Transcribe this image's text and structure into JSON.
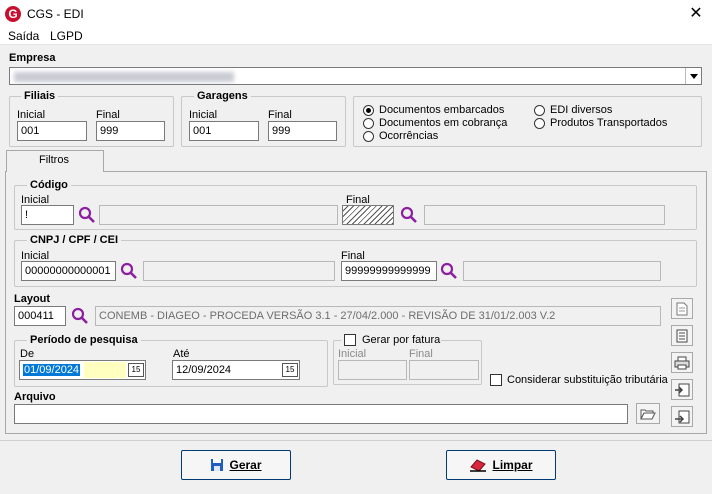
{
  "window": {
    "title": "CGS - EDI",
    "close_glyph": "✕"
  },
  "menu": [
    "Saída",
    "LGPD"
  ],
  "empresa": {
    "label": "Empresa",
    "value": ""
  },
  "filiais": {
    "label": "Filiais",
    "inicial_label": "Inicial",
    "inicial": "001",
    "final_label": "Final",
    "final": "999"
  },
  "garagens": {
    "label": "Garagens",
    "inicial_label": "Inicial",
    "inicial": "001",
    "final_label": "Final",
    "final": "999"
  },
  "doc_options": [
    {
      "label": "Documentos embarcados",
      "selected": true
    },
    {
      "label": "Documentos em cobrança",
      "selected": false
    },
    {
      "label": "Ocorrências",
      "selected": false
    },
    {
      "label": "EDI diversos",
      "selected": false
    },
    {
      "label": "Produtos Transportados",
      "selected": false
    }
  ],
  "tab": {
    "label": "Filtros"
  },
  "codigo": {
    "label": "Código",
    "inicial_label": "Inicial",
    "inicial": "!",
    "final_label": "Final",
    "final_desc": ""
  },
  "cnpj": {
    "label": "CNPJ / CPF / CEI",
    "inicial_label": "Inicial",
    "inicial": "00000000000001",
    "final_label": "Final",
    "final": "99999999999999"
  },
  "layout": {
    "label": "Layout",
    "code": "000411",
    "desc": "CONEMB - DIAGEO  - PROCEDA VERSÃO 3.1 - 27/04/2.000 - REVISÃO DE 31/01/2.003 V.2"
  },
  "periodo": {
    "label": "Período de pesquisa",
    "de_label": "De",
    "de": "01/09/2024",
    "ate_label": "Até",
    "ate": "12/09/2024",
    "cal_glyph": "15"
  },
  "fatura": {
    "label": "Gerar por fatura",
    "inicial_label": "Inicial",
    "final_label": "Final",
    "checked": false
  },
  "substituicao": {
    "label": "Considerar substituição tributária",
    "checked": false
  },
  "arquivo": {
    "label": "Arquivo",
    "value": ""
  },
  "buttons": {
    "gerar": "Gerar",
    "limpar": "Limpar"
  },
  "colors": {
    "accent": "#c8102e",
    "selection": "#0078d7",
    "highlight": "#ffffc0"
  }
}
